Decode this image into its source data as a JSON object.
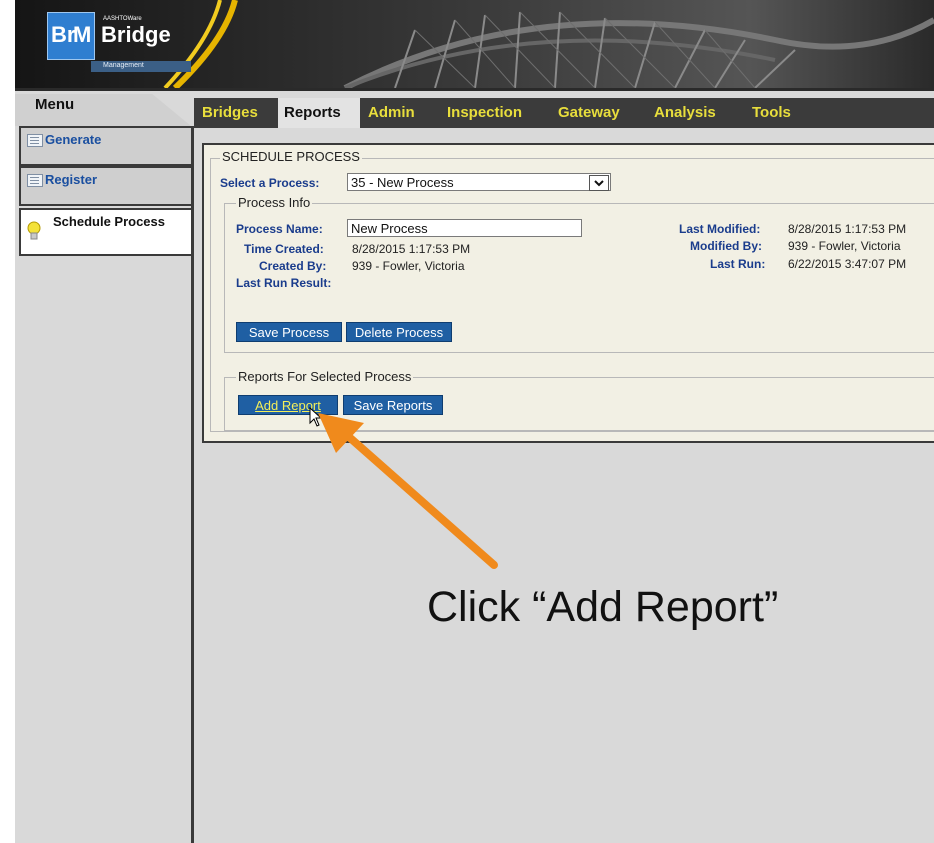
{
  "logo": {
    "brand_left": "Br",
    "brand_right": "M",
    "small_text": "AASHTOWare",
    "product": "Bridge",
    "strip_text": "Management"
  },
  "sidebar": {
    "title": "Menu",
    "items": [
      {
        "label": "Generate",
        "icon": "list-icon"
      },
      {
        "label": "Register",
        "icon": "list-icon"
      },
      {
        "label": "Schedule Process",
        "icon": "lightbulb-icon",
        "active": true
      }
    ]
  },
  "nav": {
    "tabs": [
      {
        "label": "Bridges"
      },
      {
        "label": "Reports",
        "active": true
      },
      {
        "label": "Admin"
      },
      {
        "label": "Inspection"
      },
      {
        "label": "Gateway"
      },
      {
        "label": "Analysis"
      },
      {
        "label": "Tools"
      }
    ]
  },
  "schedule": {
    "legend": "SCHEDULE PROCESS",
    "select_label": "Select a Process:",
    "select_value": "35 - New Process",
    "info_legend": "Process Info",
    "process_name_label": "Process Name:",
    "process_name_value": "New Process",
    "time_created_label": "Time Created:",
    "time_created_value": "8/28/2015 1:17:53 PM",
    "created_by_label": "Created By:",
    "created_by_value": "939 - Fowler, Victoria",
    "last_run_result_label": "Last Run Result:",
    "last_modified_label": "Last Modified:",
    "last_modified_value": "8/28/2015 1:17:53 PM",
    "modified_by_label": "Modified By:",
    "modified_by_value": "939 - Fowler, Victoria",
    "last_run_label": "Last Run:",
    "last_run_value": "6/22/2015 3:47:07 PM",
    "save_process": "Save Process",
    "delete_process": "Delete Process",
    "reports_legend": "Reports For Selected Process",
    "add_report": "Add Report",
    "save_reports": "Save Reports"
  },
  "annotation": {
    "caption": "Click “Add Report”",
    "arrow_color": "#f08a1c"
  },
  "colors": {
    "nav_text": "#e8de3c",
    "button_bg": "#1f5fa3",
    "label_blue": "#1a3c8c"
  }
}
